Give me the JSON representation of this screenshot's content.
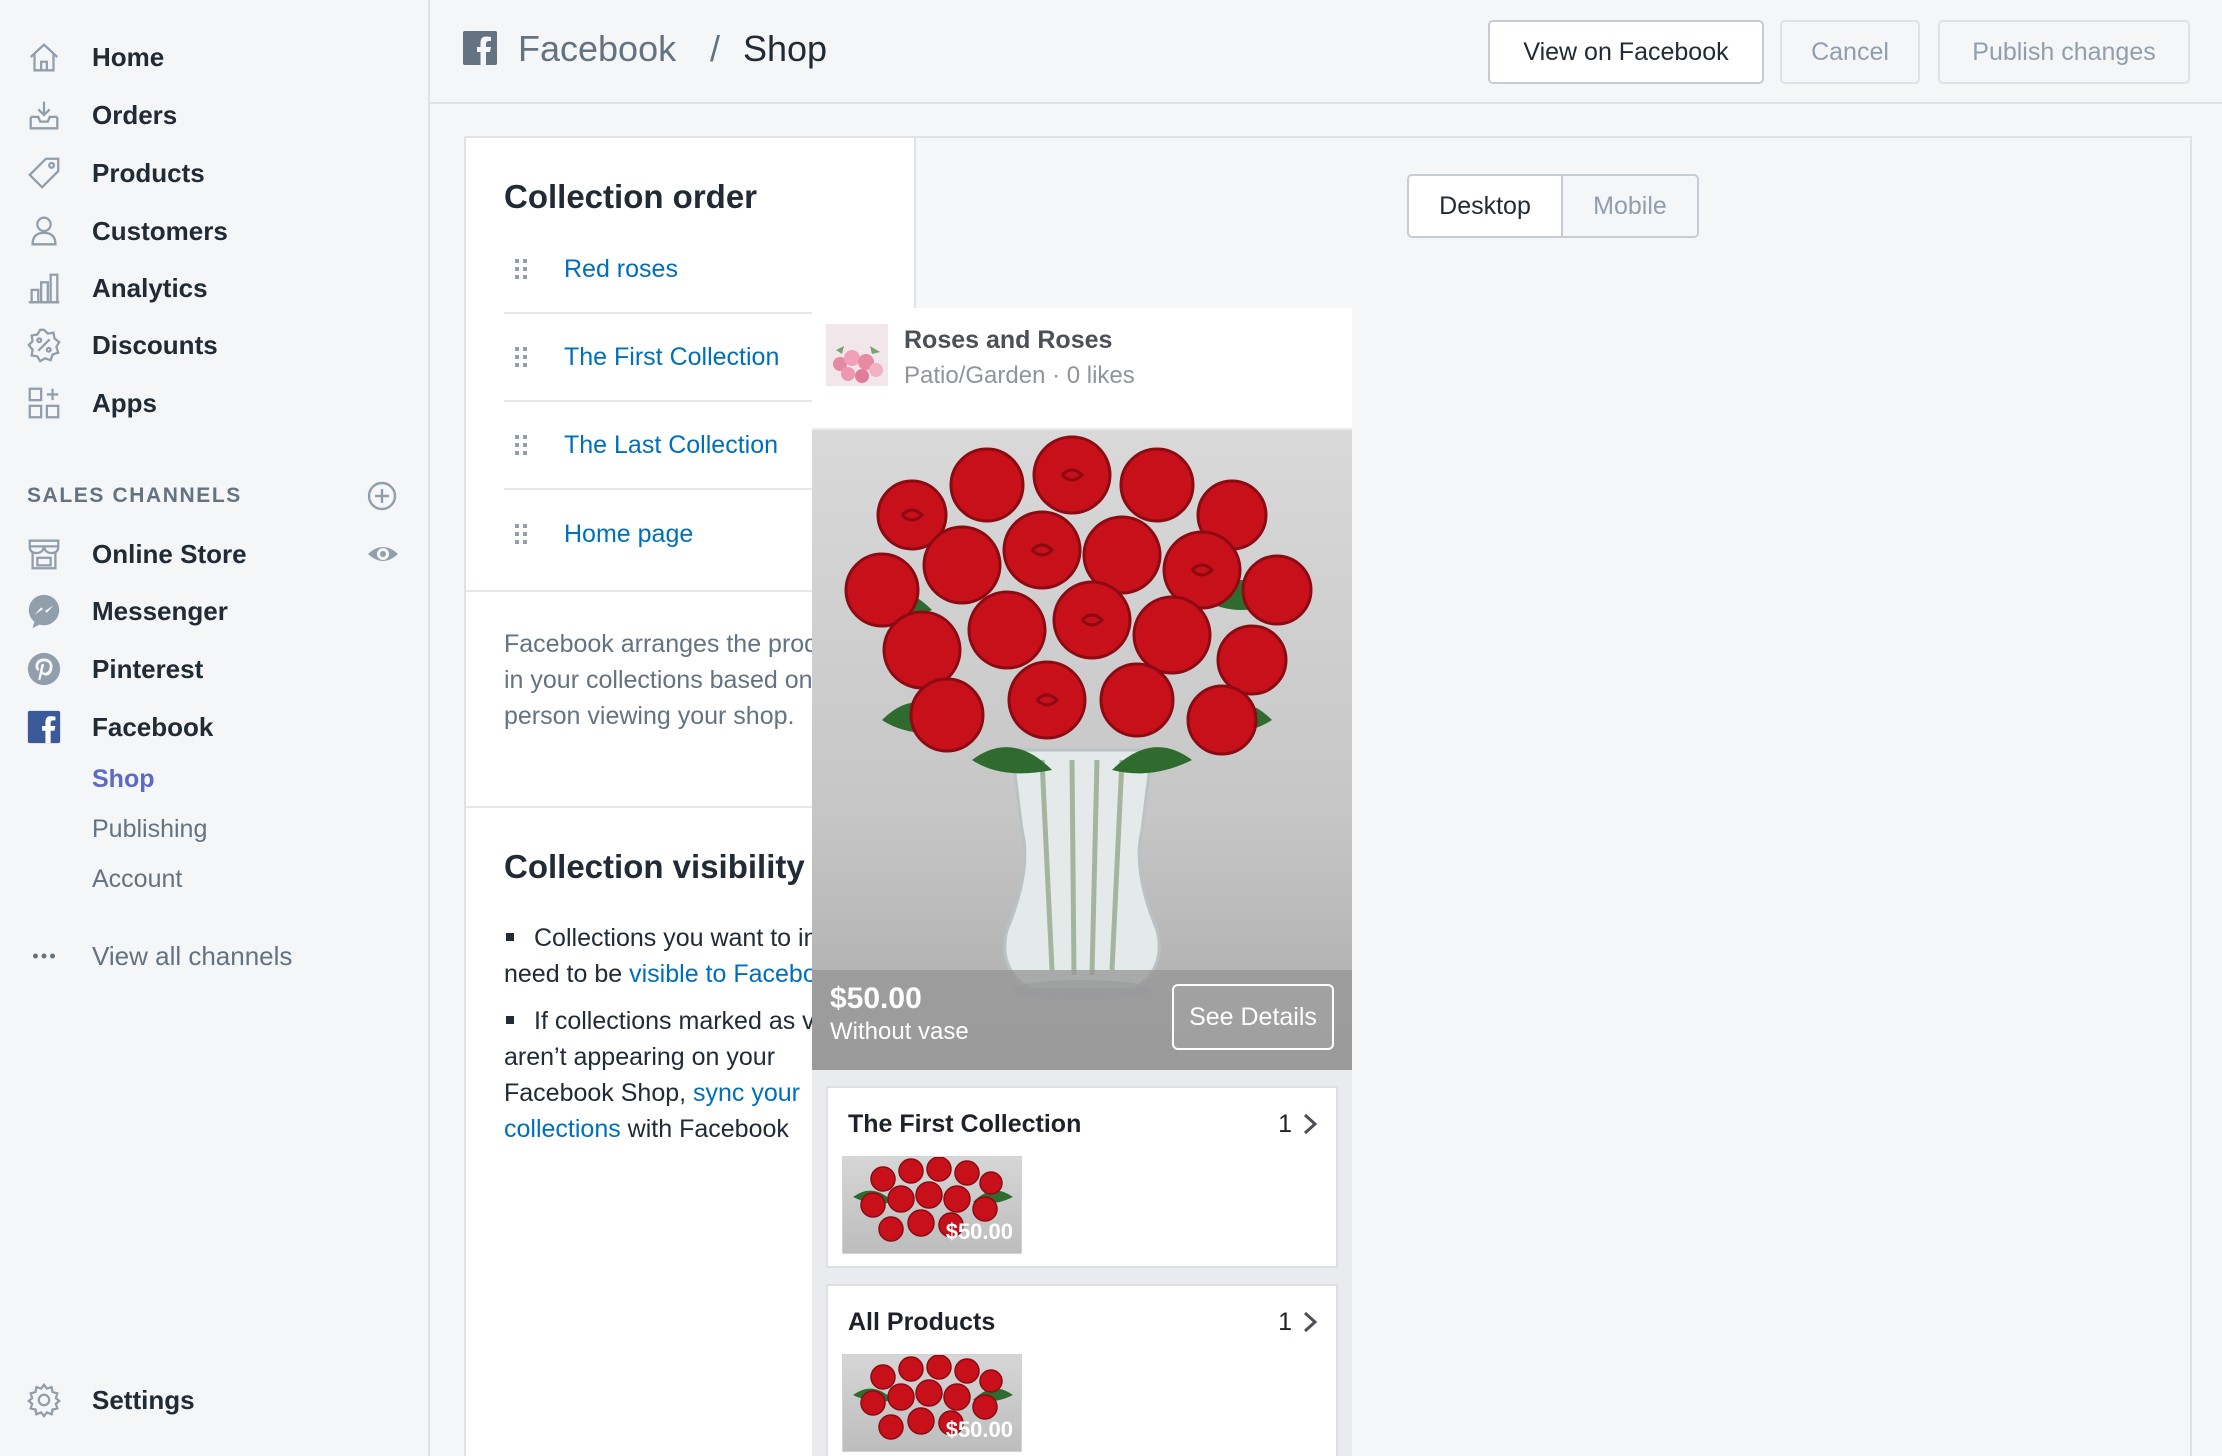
{
  "sidebar": {
    "nav": [
      {
        "label": "Home",
        "icon": "home-icon"
      },
      {
        "label": "Orders",
        "icon": "orders-icon"
      },
      {
        "label": "Products",
        "icon": "tag-icon"
      },
      {
        "label": "Customers",
        "icon": "person-icon"
      },
      {
        "label": "Analytics",
        "icon": "bar-chart-icon"
      },
      {
        "label": "Discounts",
        "icon": "discount-icon"
      },
      {
        "label": "Apps",
        "icon": "apps-icon"
      }
    ],
    "sales_channels_heading": "SALES CHANNELS",
    "channels": [
      {
        "label": "Online Store",
        "icon": "store-icon"
      },
      {
        "label": "Messenger",
        "icon": "messenger-icon"
      },
      {
        "label": "Pinterest",
        "icon": "pinterest-icon"
      },
      {
        "label": "Facebook",
        "icon": "facebook-icon"
      }
    ],
    "facebook_sub": [
      {
        "label": "Shop",
        "active": true
      },
      {
        "label": "Publishing",
        "active": false
      },
      {
        "label": "Account",
        "active": false
      }
    ],
    "view_all": "View all channels",
    "settings": "Settings"
  },
  "topbar": {
    "crumb_parent": "Facebook",
    "crumb_separator": "/",
    "crumb_current": "Shop",
    "view_button": "View on Facebook",
    "cancel_button": "Cancel",
    "publish_button": "Publish changes"
  },
  "collection_order": {
    "title": "Collection order",
    "items": [
      {
        "label": "Red roses",
        "warning": false
      },
      {
        "label": "The First Collection",
        "warning": false
      },
      {
        "label": "The Last Collection",
        "warning": true
      },
      {
        "label": "Home page",
        "warning": true
      }
    ],
    "warning_glyph": "!",
    "note": "Facebook arranges the products in your collections based on the person viewing your shop."
  },
  "collection_visibility": {
    "title": "Collection visibility",
    "bullet1_text": "Collections you want to include need to be ",
    "bullet1_link": "visible to Facebook",
    "bullet2_text": "If collections marked as visible aren’t appearing on your Facebook Shop, ",
    "bullet2_link": "sync your collections",
    "bullet2_tail": " with Facebook"
  },
  "preview": {
    "toggle_desktop": "Desktop",
    "toggle_mobile": "Mobile",
    "selected": "Desktop",
    "page_name": "Roses and Roses",
    "page_meta": "Patio/Garden · 0 likes",
    "hero_price": "$50.00",
    "hero_sub": "Without vase",
    "see_details": "See Details",
    "collections": [
      {
        "title": "The First Collection",
        "count": "1",
        "price": "$50.00"
      },
      {
        "title": "All Products",
        "count": "1",
        "price": "$50.00"
      }
    ]
  },
  "colors": {
    "link": "#006fbb",
    "active_nav": "#5c6ac4",
    "warning": "#bf0711",
    "facebook_blue": "#3b5998"
  }
}
